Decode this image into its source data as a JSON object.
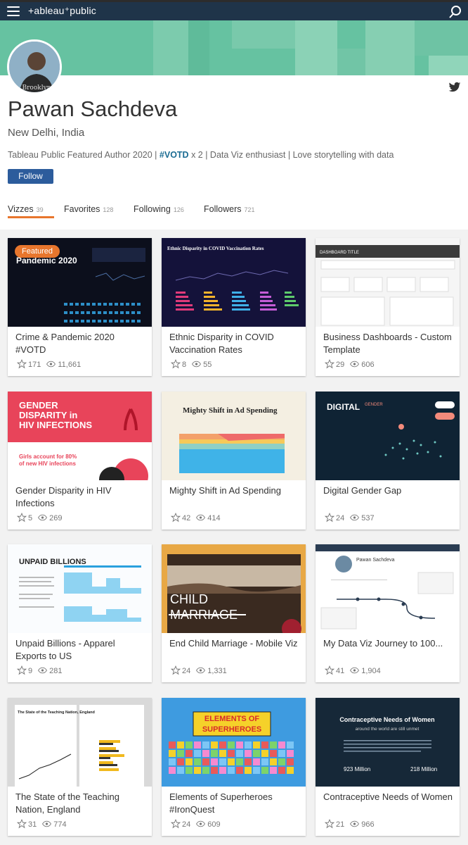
{
  "header": {
    "logo_text": "+ableau⁺public",
    "colors": {
      "bar": "#1f3449",
      "banner": "#66c2a1"
    }
  },
  "profile": {
    "name": "Pawan Sachdeva",
    "location": "New Delhi, India",
    "bio_prefix": "Tableau Public Featured Author 2020 | ",
    "bio_hashtag": "#VOTD",
    "bio_suffix": " x 2 | Data Viz enthusiast | Love storytelling with data",
    "follow_label": "Follow"
  },
  "tabs": [
    {
      "label": "Vizzes",
      "count": "39"
    },
    {
      "label": "Favorites",
      "count": "128"
    },
    {
      "label": "Following",
      "count": "126"
    },
    {
      "label": "Followers",
      "count": "721"
    }
  ],
  "featured_label": "Featured",
  "vizzes": [
    {
      "title": "Crime & Pandemic 2020 #VOTD",
      "favorites": "171",
      "views": "11,661",
      "thumb_text": "Pandemic 2020"
    },
    {
      "title": "Ethnic Disparity in COVID Vaccination Rates",
      "favorites": "8",
      "views": "55",
      "thumb_text": "Ethnic Disparity in COVID Vaccination Rates"
    },
    {
      "title": "Business Dashboards - Custom Template",
      "favorites": "29",
      "views": "606",
      "thumb_text": "DASHBOARD TITLE"
    },
    {
      "title": "Gender Disparity in HIV Infections",
      "favorites": "5",
      "views": "269",
      "thumb_text": "GENDER DISPARITY in HIV INFECTIONS"
    },
    {
      "title": "Mighty Shift in Ad Spending",
      "favorites": "42",
      "views": "414",
      "thumb_text": "Mighty Shift in Ad Spending"
    },
    {
      "title": "Digital Gender Gap",
      "favorites": "24",
      "views": "537",
      "thumb_text": "DIGITAL GENDER DIVIDE"
    },
    {
      "title": "Unpaid Billions - Apparel Exports to US",
      "favorites": "9",
      "views": "281",
      "thumb_text": "UNPAID BILLIONS"
    },
    {
      "title": "End Child Marriage - Mobile Viz",
      "favorites": "24",
      "views": "1,331",
      "thumb_text": "CHILD MARRIAGE"
    },
    {
      "title": "My Data Viz Journey to 100...",
      "favorites": "41",
      "views": "1,904",
      "thumb_text": "Pawan Sachdeva"
    },
    {
      "title": "The State of the Teaching Nation, England",
      "favorites": "31",
      "views": "774",
      "thumb_text": "The State of the Teaching Nation, England"
    },
    {
      "title": "Elements of Superheroes #IronQuest",
      "favorites": "24",
      "views": "609",
      "thumb_text": "ELEMENTS OF SUPERHEROES"
    },
    {
      "title": "Contraceptive Needs of Women",
      "favorites": "21",
      "views": "966",
      "thumb_text": "Contraceptive Needs of Women"
    }
  ]
}
